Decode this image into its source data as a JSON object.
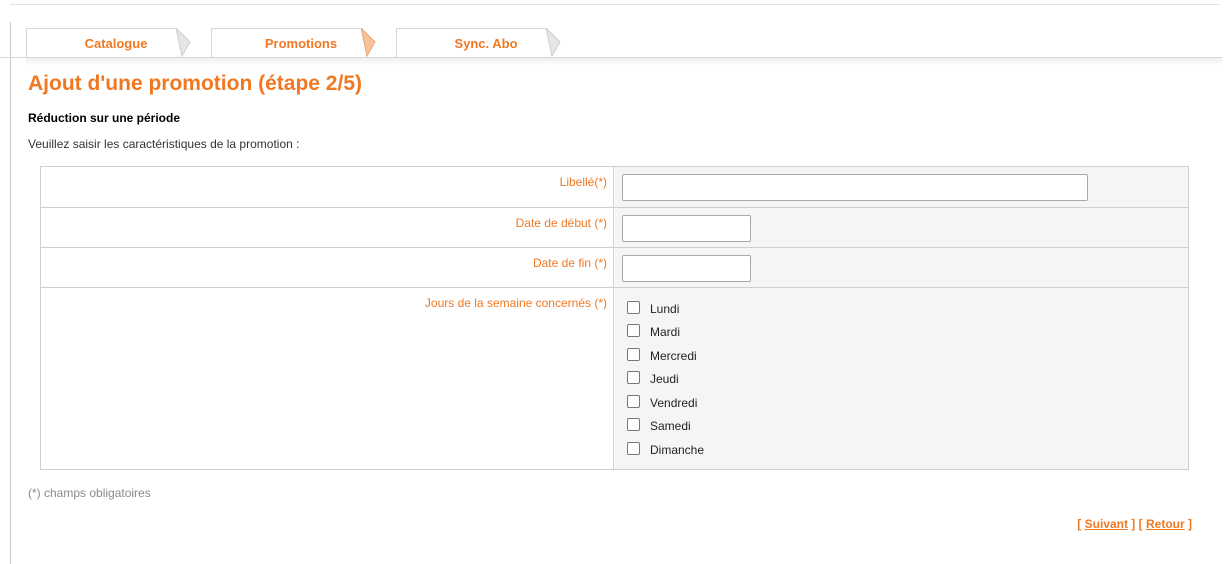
{
  "tabs": [
    {
      "label": "Catalogue"
    },
    {
      "label": "Promotions"
    },
    {
      "label": "Sync. Abo"
    }
  ],
  "page_title": "Ajout d'une promotion (étape 2/5)",
  "subtitle": "Réduction sur une période",
  "instruction": "Veuillez saisir les caractéristiques de la promotion :",
  "form": {
    "label_field": {
      "label": "Libellé(*)",
      "value": ""
    },
    "start_date": {
      "label": "Date de début (*)",
      "value": ""
    },
    "end_date": {
      "label": "Date de fin (*)",
      "value": ""
    },
    "days": {
      "label": "Jours de la semaine concernés (*)",
      "options": [
        {
          "label": "Lundi",
          "checked": false
        },
        {
          "label": "Mardi",
          "checked": false
        },
        {
          "label": "Mercredi",
          "checked": false
        },
        {
          "label": "Jeudi",
          "checked": false
        },
        {
          "label": "Vendredi",
          "checked": false
        },
        {
          "label": "Samedi",
          "checked": false
        },
        {
          "label": "Dimanche",
          "checked": false
        }
      ]
    }
  },
  "required_note": "(*) champs obligatoires",
  "actions": {
    "next_label": "Suivant",
    "back_label": "Retour"
  },
  "colors": {
    "accent": "#f07823",
    "border": "#cfcfcf",
    "value_cell_bg": "#f5f5f5"
  }
}
